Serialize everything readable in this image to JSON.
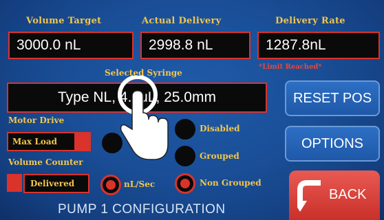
{
  "header": {
    "volume_target_label": "Volume Target",
    "actual_delivery_label": "Actual Delivery",
    "delivery_rate_label": "Delivery Rate"
  },
  "values": {
    "volume_target": "3000.0 nL",
    "actual_delivery": "2998.8 nL",
    "delivery_rate": "1287.8nL"
  },
  "limit_text": "*Limit Reached*",
  "syringe": {
    "label": "Selected Syringe",
    "value": "Type NL, 4.0uL, 25.0mm"
  },
  "motor_drive": {
    "label": "Motor Drive",
    "value": "Max Load"
  },
  "volume_counter": {
    "label": "Volume Counter",
    "value": "Delivered"
  },
  "radios": {
    "disabled": "Disabled",
    "grouped": "Grouped",
    "nl_sec": "nL/Sec",
    "non_grouped": "Non Grouped"
  },
  "buttons": {
    "reset_pos": "RESET POS",
    "options": "OPTIONS",
    "back": "BACK"
  },
  "footer": "PUMP 1 CONFIGURATION",
  "colors": {
    "accent_red": "#d9332b",
    "label_gold": "#f3c64a",
    "background_blue": "#1a4f98"
  }
}
